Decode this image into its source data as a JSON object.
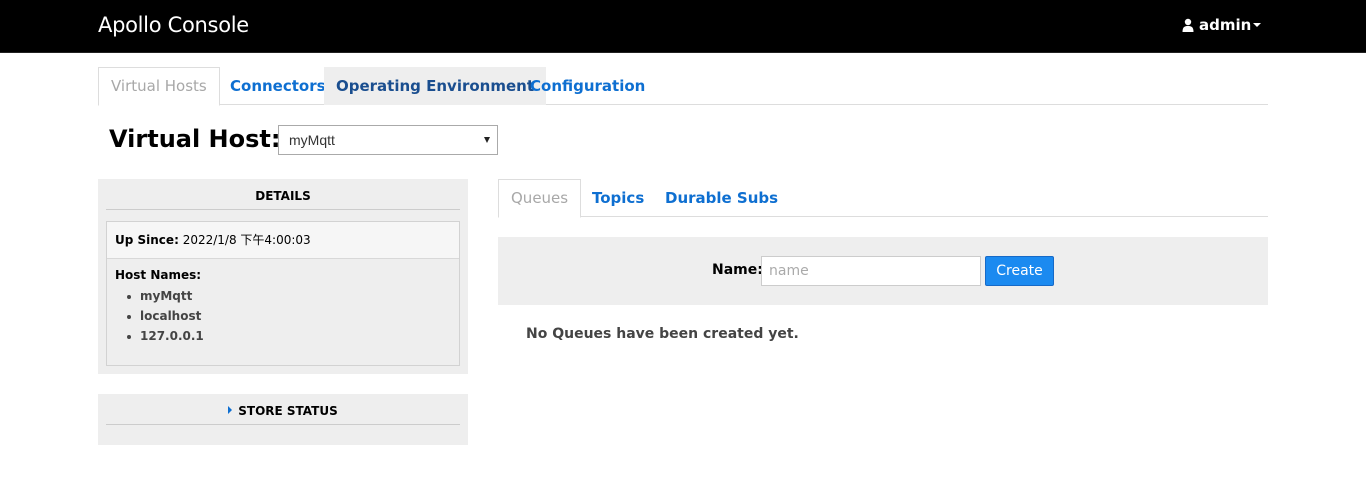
{
  "header": {
    "brand": "Apollo Console",
    "user": "admin",
    "user_icon": "user-icon"
  },
  "main_tabs": [
    {
      "label": "Virtual Hosts",
      "active": true
    },
    {
      "label": "Connectors",
      "active": false
    },
    {
      "label": "Operating Environment",
      "active": false
    },
    {
      "label": "Configuration",
      "active": false
    }
  ],
  "virtual_host": {
    "label": "Virtual Host:",
    "selected": "myMqtt"
  },
  "details": {
    "title": "DETAILS",
    "up_since_label": "Up Since:",
    "up_since_value": "2022/1/8 下午4:00:03",
    "host_names_label": "Host Names:",
    "host_names": [
      "myMqtt",
      "localhost",
      "127.0.0.1"
    ]
  },
  "store_status": {
    "title": "STORE STATUS"
  },
  "sub_tabs": [
    {
      "label": "Queues",
      "active": true
    },
    {
      "label": "Topics",
      "active": false
    },
    {
      "label": "Durable Subs",
      "active": false
    }
  ],
  "create_form": {
    "name_label": "Name:",
    "name_placeholder": "name",
    "name_value": "",
    "create_label": "Create"
  },
  "empty_message": "No Queues have been created yet.",
  "colors": {
    "navbar": "#000000",
    "link": "#0e6fd1",
    "button": "#1b8af0",
    "panel": "#eeeeee"
  }
}
